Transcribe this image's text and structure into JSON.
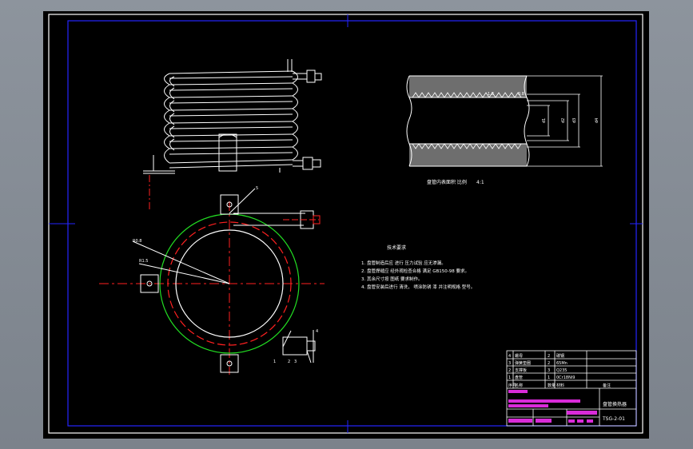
{
  "drawing": {
    "background": "#000000",
    "colors": {
      "frame": "#2424ff",
      "outline": "#ffffff",
      "center": "#ff2020",
      "green": "#22dd22",
      "magenta": "#ff33ff"
    }
  },
  "coil_view": {},
  "plan_view": {
    "dim_r1": "R0.8",
    "dim_r2": "R1.5",
    "callout_top": "5",
    "callout_1": "1",
    "callout_2": "2",
    "callout_3": "3",
    "callout_4": "4"
  },
  "section_view": {
    "caption": "盘管内表面积  比例",
    "caption_scale": "4:1",
    "dim_1": "1.8",
    "dim_2": "0.8",
    "dim_d1": "d1",
    "dim_d2": "d2",
    "dim_d3": "d3",
    "dim_d4": "d4"
  },
  "notes": {
    "title": "技术要求",
    "items": [
      "1.  盘管制造后应  进行  压力试验  应无渗漏。",
      "2.  盘管焊缝应  经外观检查合格  满足 GB150-98 要求。",
      "3.  其余尺寸按  图纸  要求制作。",
      "4.  盘管安装后进行  清洗，  喷涂防锈  漆  并注明规格  型号。"
    ]
  },
  "title_block": {
    "rows": [
      [
        "4",
        "螺母",
        "2",
        "碳钢",
        ""
      ],
      [
        "3",
        "弹簧垫圈",
        "2",
        "65Mn",
        ""
      ],
      [
        "2",
        "支撑板",
        "3",
        "Q235",
        ""
      ],
      [
        "1",
        "盘管",
        "1",
        "0Cr18Ni9",
        ""
      ],
      [
        "序号",
        "名称",
        "数量",
        "材料",
        "备注"
      ]
    ],
    "drawing_name": "盘管换热器",
    "drawing_no": "TSG-2-01"
  }
}
